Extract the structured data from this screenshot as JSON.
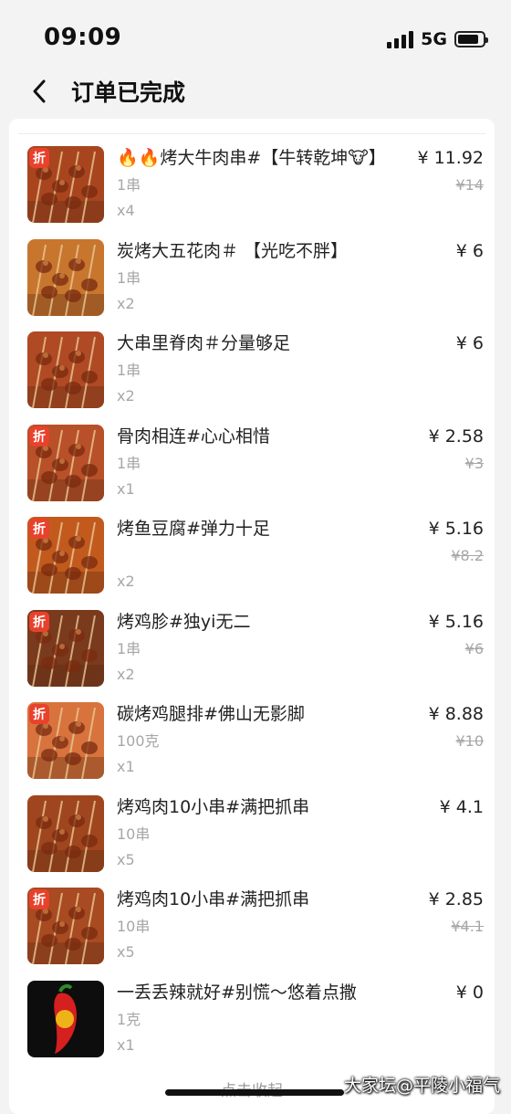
{
  "status_bar": {
    "time": "09:09",
    "network": "5G",
    "signal_bars": 4,
    "battery_level": 0.85
  },
  "nav": {
    "back_icon": "chevron-left-icon",
    "title": "订单已完成"
  },
  "items": [
    {
      "name": "🔥🔥烤大牛肉串#【牛转乾坤🐮】",
      "spec": "1串",
      "qty": "x4",
      "price": "¥ 11.92",
      "orig_price": "¥14",
      "badge": "折",
      "thumb_color": "#a8451f"
    },
    {
      "name": "炭烤大五花肉＃ 【光吃不胖】",
      "spec": "1串",
      "qty": "x2",
      "price": "¥ 6",
      "orig_price": "",
      "badge": "",
      "thumb_color": "#c8762e"
    },
    {
      "name": "大串里脊肉＃分量够足",
      "spec": "1串",
      "qty": "x2",
      "price": "¥ 6",
      "orig_price": "",
      "badge": "",
      "thumb_color": "#b04a25"
    },
    {
      "name": "骨肉相连#心心相惜",
      "spec": "1串",
      "qty": "x1",
      "price": "¥ 2.58",
      "orig_price": "¥3",
      "badge": "折",
      "thumb_color": "#b8502a"
    },
    {
      "name": "烤鱼豆腐#弹力十足",
      "spec": "",
      "qty": "x2",
      "price": "¥ 5.16",
      "orig_price": "¥8.2",
      "badge": "折",
      "thumb_color": "#c25a1e"
    },
    {
      "name": "烤鸡胗#独yi无二",
      "spec": "1串",
      "qty": "x2",
      "price": "¥ 5.16",
      "orig_price": "¥6",
      "badge": "折",
      "thumb_color": "#7a3a1e"
    },
    {
      "name": "碳烤鸡腿排#佛山无影脚",
      "spec": "100克",
      "qty": "x1",
      "price": "¥ 8.88",
      "orig_price": "¥10",
      "badge": "折",
      "thumb_color": "#d8733e"
    },
    {
      "name": "烤鸡肉10小串#满把抓串",
      "spec": "10串",
      "qty": "x5",
      "price": "¥ 4.1",
      "orig_price": "",
      "badge": "",
      "thumb_color": "#a0461f"
    },
    {
      "name": "烤鸡肉10小串#满把抓串",
      "spec": "10串",
      "qty": "x5",
      "price": "¥ 2.85",
      "orig_price": "¥4.1",
      "badge": "折",
      "thumb_color": "#a84a22"
    },
    {
      "name": "一丢丢辣就好#别慌～悠着点撒",
      "spec": "1克",
      "qty": "x1",
      "price": "¥ 0",
      "orig_price": "",
      "badge": "",
      "thumb_color": "#0d0d0d"
    }
  ],
  "footer": {
    "fold_label": "点击收起",
    "watermark": "大家坛@平陵小福气"
  },
  "colors": {
    "badge_red": "#e8412c",
    "background": "#f3f3f3",
    "card": "#ffffff"
  }
}
